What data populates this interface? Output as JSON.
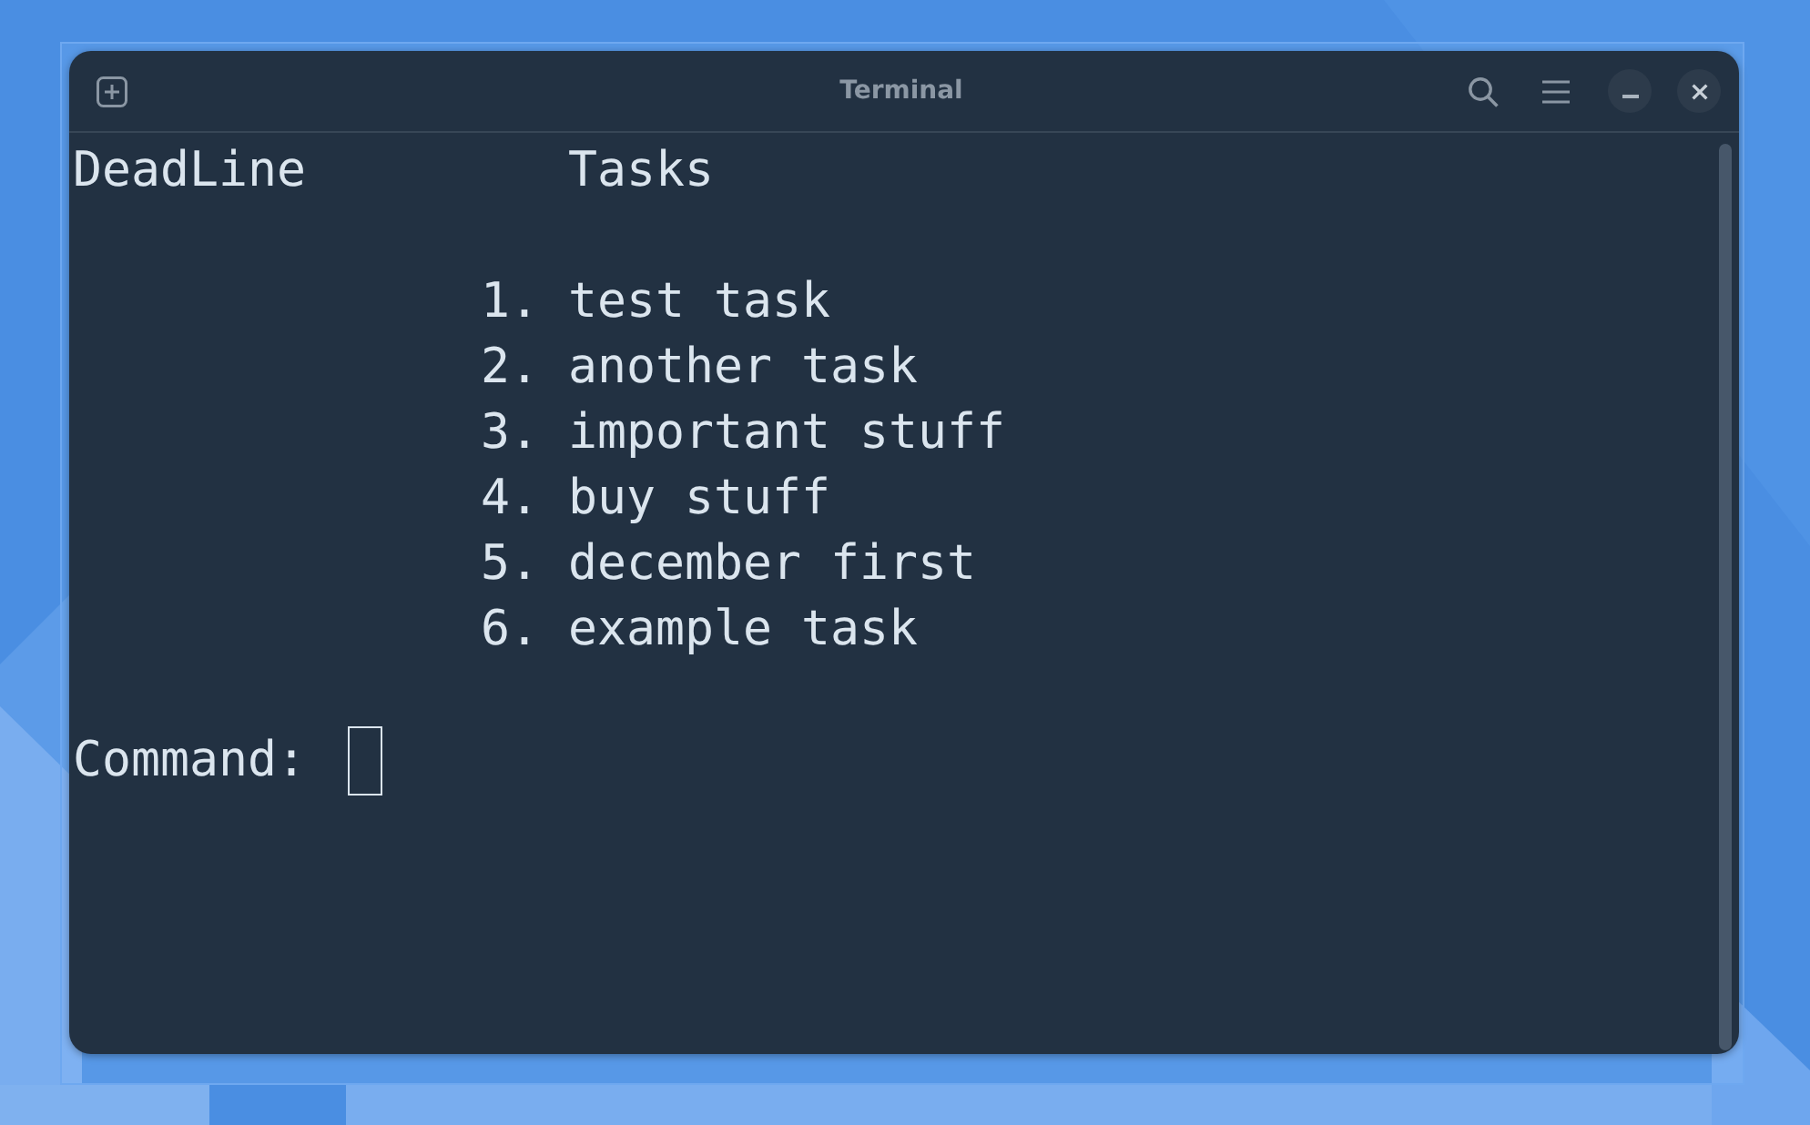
{
  "window": {
    "title": "Terminal"
  },
  "terminal": {
    "headings": [
      "DeadLine",
      "Tasks"
    ],
    "tasks": [
      {
        "number": "1.",
        "text": "test task"
      },
      {
        "number": "2.",
        "text": "another task"
      },
      {
        "number": "3.",
        "text": "important stuff"
      },
      {
        "number": "4.",
        "text": "buy stuff"
      },
      {
        "number": "5.",
        "text": "december first"
      },
      {
        "number": "6.",
        "text": "example task"
      }
    ],
    "prompt": "Command:"
  }
}
